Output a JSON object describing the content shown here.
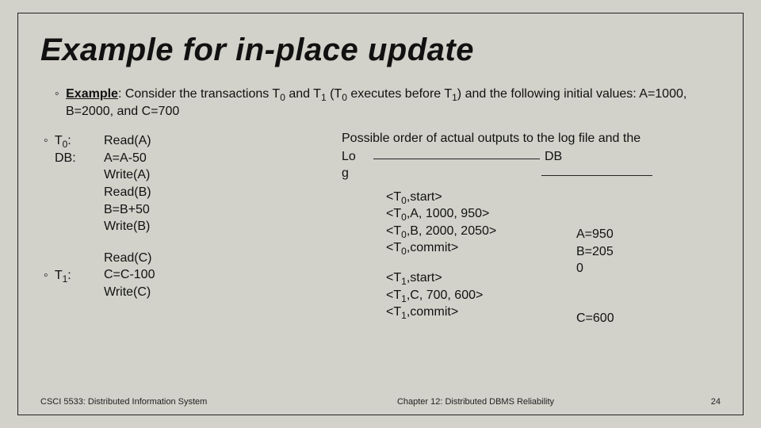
{
  "title": "Example for in-place update",
  "example": {
    "label": "Example",
    "text_before": ": Consider the transactions T",
    "t0": "0",
    "text_mid1": " and T",
    "t1": "1",
    "text_mid2": " (T",
    "text_mid3": " executes before T",
    "text_after": ") and the following initial values: A=1000, B=2000, and C=700"
  },
  "tx0": {
    "label_line1": "T",
    "label_sub": "0",
    "label_line1_colon": ":",
    "label_line2": "DB:",
    "ops": [
      "Read(A)",
      "A=A-50",
      "Write(A)",
      "Read(B)",
      "B=B+50",
      "Write(B)"
    ]
  },
  "tx1": {
    "label_line1": "T",
    "label_sub": "1",
    "label_colon": ":",
    "ops": [
      "Read(C)",
      "C=C-100",
      "Write(C)"
    ]
  },
  "right": {
    "possible_text": "Possible order of actual outputs to the log file and the",
    "log_label_1": "Lo",
    "log_label_2": "g",
    "db_label": "DB",
    "log1": [
      "<T0,start>",
      "<T0,A, 1000, 950>",
      "<T0,B, 2000, 2050>",
      "<T0,commit>"
    ],
    "log2": [
      "<T1,start>",
      "<T1,C, 700, 600>",
      "<T1,commit>"
    ],
    "db1": [
      "A=950",
      "B=205",
      "0"
    ],
    "db2": [
      "C=600"
    ]
  },
  "footer": {
    "left": "CSCI 5533: Distributed Information System",
    "center": "Chapter 12: Distributed DBMS Reliability",
    "page": "24"
  }
}
